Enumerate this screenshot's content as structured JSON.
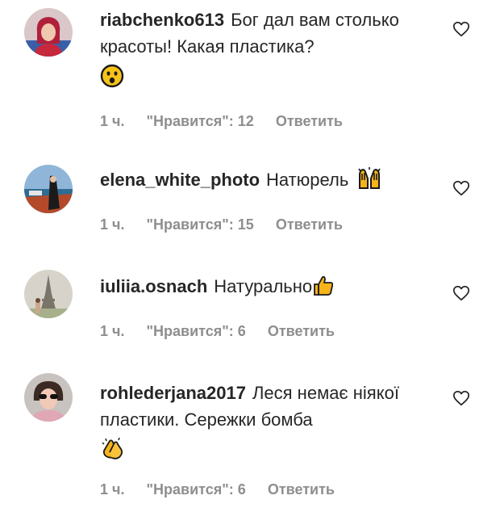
{
  "comments": [
    {
      "username": "riabchenko613",
      "text": "Бог дал вам столько красоты! Какая пластика?",
      "emoji": "hushed-face-emoji",
      "time": "1 ч.",
      "likes": "\"Нравится\": 12",
      "reply": "Ответить",
      "avatar": "woman-red-hair-avatar"
    },
    {
      "username": "elena_white_photo",
      "text": "Натюрель",
      "emoji": "raised-hands-emoji",
      "time": "1 ч.",
      "likes": "\"Нравится\": 15",
      "reply": "Ответить",
      "avatar": "photographer-sea-avatar"
    },
    {
      "username": "iuliia.osnach",
      "text": "Натурально",
      "emoji": "thumbs-up-emoji",
      "time": "1 ч.",
      "likes": "\"Нравится\": 6",
      "reply": "Ответить",
      "avatar": "eiffel-tower-avatar"
    },
    {
      "username": "rohlederjana2017",
      "text": "Леся немає ніякої пластики. Сережки бомба",
      "emoji": "clapping-hands-emoji",
      "time": "1 ч.",
      "likes": "\"Нравится\": 6",
      "reply": "Ответить",
      "avatar": "woman-sunglasses-avatar"
    }
  ],
  "colors": {
    "text": "#262626",
    "meta": "#8e8e8e",
    "emoji": "#f5c518"
  }
}
